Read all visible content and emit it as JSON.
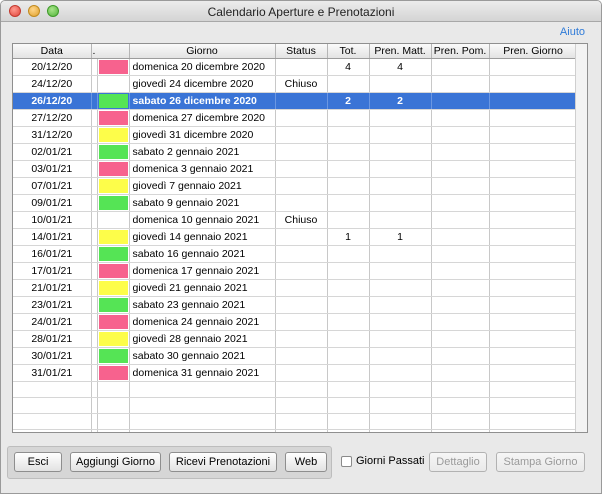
{
  "window": {
    "title": "Calendario Aperture e Prenotazioni"
  },
  "help_label": "Aiuto",
  "table": {
    "headers": [
      "Data",
      ".",
      "Giorno",
      "Status",
      "Tot.",
      "Pren. Matt.",
      "Pren. Pom.",
      "Pren. Giorno"
    ],
    "colors": {
      "pink": "#f7628e",
      "green": "#55e455",
      "yellow": "#fdfd4a",
      "white": "#ffffff",
      "selected_bg": "#3a74d6"
    },
    "rows": [
      {
        "data": "20/12/20",
        "color": "pink",
        "giorno": "domenica 20 dicembre 2020",
        "status": "",
        "tot": "4",
        "matt": "4",
        "pom": "",
        "giornata": ""
      },
      {
        "data": "24/12/20",
        "color": "white",
        "giorno": "giovedì 24 dicembre 2020",
        "status": "Chiuso",
        "tot": "",
        "matt": "",
        "pom": "",
        "giornata": ""
      },
      {
        "data": "26/12/20",
        "color": "green",
        "giorno": "sabato 26 dicembre 2020",
        "status": "",
        "tot": "2",
        "matt": "2",
        "pom": "",
        "giornata": "",
        "selected": true
      },
      {
        "data": "27/12/20",
        "color": "pink",
        "giorno": "domenica 27 dicembre 2020",
        "status": "",
        "tot": "",
        "matt": "",
        "pom": "",
        "giornata": ""
      },
      {
        "data": "31/12/20",
        "color": "yellow",
        "giorno": "giovedì 31 dicembre 2020",
        "status": "",
        "tot": "",
        "matt": "",
        "pom": "",
        "giornata": ""
      },
      {
        "data": "02/01/21",
        "color": "green",
        "giorno": "sabato 2 gennaio 2021",
        "status": "",
        "tot": "",
        "matt": "",
        "pom": "",
        "giornata": ""
      },
      {
        "data": "03/01/21",
        "color": "pink",
        "giorno": "domenica 3 gennaio 2021",
        "status": "",
        "tot": "",
        "matt": "",
        "pom": "",
        "giornata": ""
      },
      {
        "data": "07/01/21",
        "color": "yellow",
        "giorno": "giovedì 7 gennaio 2021",
        "status": "",
        "tot": "",
        "matt": "",
        "pom": "",
        "giornata": ""
      },
      {
        "data": "09/01/21",
        "color": "green",
        "giorno": "sabato 9 gennaio 2021",
        "status": "",
        "tot": "",
        "matt": "",
        "pom": "",
        "giornata": ""
      },
      {
        "data": "10/01/21",
        "color": "white",
        "giorno": "domenica 10 gennaio 2021",
        "status": "Chiuso",
        "tot": "",
        "matt": "",
        "pom": "",
        "giornata": ""
      },
      {
        "data": "14/01/21",
        "color": "yellow",
        "giorno": "giovedì 14 gennaio 2021",
        "status": "",
        "tot": "1",
        "matt": "1",
        "pom": "",
        "giornata": ""
      },
      {
        "data": "16/01/21",
        "color": "green",
        "giorno": "sabato 16 gennaio 2021",
        "status": "",
        "tot": "",
        "matt": "",
        "pom": "",
        "giornata": ""
      },
      {
        "data": "17/01/21",
        "color": "pink",
        "giorno": "domenica 17 gennaio 2021",
        "status": "",
        "tot": "",
        "matt": "",
        "pom": "",
        "giornata": ""
      },
      {
        "data": "21/01/21",
        "color": "yellow",
        "giorno": "giovedì 21 gennaio 2021",
        "status": "",
        "tot": "",
        "matt": "",
        "pom": "",
        "giornata": ""
      },
      {
        "data": "23/01/21",
        "color": "green",
        "giorno": "sabato 23 gennaio 2021",
        "status": "",
        "tot": "",
        "matt": "",
        "pom": "",
        "giornata": ""
      },
      {
        "data": "24/01/21",
        "color": "pink",
        "giorno": "domenica 24 gennaio 2021",
        "status": "",
        "tot": "",
        "matt": "",
        "pom": "",
        "giornata": ""
      },
      {
        "data": "28/01/21",
        "color": "yellow",
        "giorno": "giovedì 28 gennaio 2021",
        "status": "",
        "tot": "",
        "matt": "",
        "pom": "",
        "giornata": ""
      },
      {
        "data": "30/01/21",
        "color": "green",
        "giorno": "sabato 30 gennaio 2021",
        "status": "",
        "tot": "",
        "matt": "",
        "pom": "",
        "giornata": ""
      },
      {
        "data": "31/01/21",
        "color": "pink",
        "giorno": "domenica 31 gennaio 2021",
        "status": "",
        "tot": "",
        "matt": "",
        "pom": "",
        "giornata": ""
      }
    ]
  },
  "buttons": {
    "esci": "Esci",
    "aggiungi": "Aggiungi Giorno",
    "ricevi": "Ricevi Prenotazioni",
    "web": "Web",
    "dettaglio": "Dettaglio",
    "stampa": "Stampa Giorno"
  },
  "checkbox": {
    "label": "Giorni Passati",
    "checked": false
  }
}
